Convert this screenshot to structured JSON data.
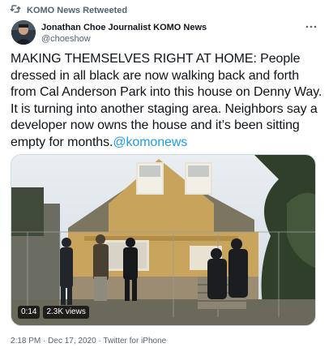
{
  "retweet": {
    "label": "KOMO News Retweeted",
    "icon": "retweet-icon"
  },
  "author": {
    "name": "Jonathan Choe Journalist KOMO News",
    "handle": "@choeshow"
  },
  "more_icon": "more-options-icon",
  "tweet": {
    "text": "MAKING THEMSELVES RIGHT AT HOME: People dressed in all black are now walking back and forth from Cal Anderson Park into this house on Denny Way. It is turning into another staging area. Neighbors say a developer now owns the house and it’s been sitting empty for months.",
    "mention": "@komonews"
  },
  "media": {
    "duration": "0:14",
    "views": "2.3K views"
  },
  "meta": {
    "time": "2:18 PM",
    "separator": "·",
    "date": "Dec 17, 2020",
    "source": "Twitter for iPhone"
  },
  "colors": {
    "link": "#1d9bf0",
    "secondary_text": "#536471"
  }
}
